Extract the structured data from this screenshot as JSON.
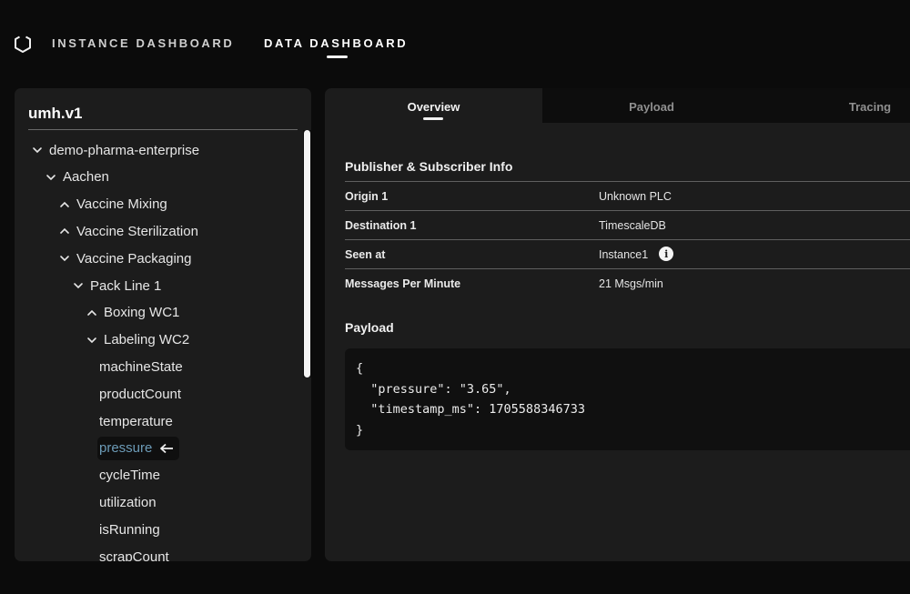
{
  "nav": {
    "logo_icon": "hexagon-logo-icon",
    "items": [
      {
        "label": "INSTANCE DASHBOARD",
        "active": false
      },
      {
        "label": "DATA DASHBOARD",
        "active": true
      }
    ]
  },
  "tree_panel": {
    "title": "umh.v1",
    "items": [
      {
        "label": "demo-pharma-enterprise",
        "level": 0,
        "chevron": "down"
      },
      {
        "label": "Aachen",
        "level": 1,
        "chevron": "down"
      },
      {
        "label": "Vaccine Mixing",
        "level": 2,
        "chevron": "up"
      },
      {
        "label": "Vaccine Sterilization",
        "level": 2,
        "chevron": "up"
      },
      {
        "label": "Vaccine Packaging",
        "level": 2,
        "chevron": "down"
      },
      {
        "label": "Pack Line 1",
        "level": 3,
        "chevron": "down"
      },
      {
        "label": "Boxing WC1",
        "level": 4,
        "chevron": "up"
      },
      {
        "label": "Labeling WC2",
        "level": 4,
        "chevron": "down"
      },
      {
        "label": "machineState",
        "level": 5,
        "chevron": "none"
      },
      {
        "label": "productCount",
        "level": 5,
        "chevron": "none"
      },
      {
        "label": "temperature",
        "level": 5,
        "chevron": "none"
      },
      {
        "label": "pressure",
        "level": 5,
        "chevron": "none",
        "selected": true
      },
      {
        "label": "cycleTime",
        "level": 5,
        "chevron": "none"
      },
      {
        "label": "utilization",
        "level": 5,
        "chevron": "none"
      },
      {
        "label": "isRunning",
        "level": 5,
        "chevron": "none"
      },
      {
        "label": "scrapCount",
        "level": 5,
        "chevron": "none"
      }
    ],
    "selected_color": "#6c9bb7"
  },
  "detail_panel": {
    "tabs": [
      {
        "label": "Overview",
        "active": true
      },
      {
        "label": "Payload",
        "active": false
      },
      {
        "label": "Tracing",
        "active": false
      }
    ],
    "info_section_title": "Publisher & Subscriber Info",
    "info_rows": [
      {
        "key": "Origin 1",
        "value": "Unknown PLC"
      },
      {
        "key": "Destination 1",
        "value": "TimescaleDB"
      },
      {
        "key": "Seen at",
        "value": "Instance1",
        "icon": "info-icon"
      },
      {
        "key": "Messages Per Minute",
        "value": "21 Msgs/min"
      }
    ],
    "payload_section_title": "Payload",
    "payload_lines": [
      "{",
      "  \"pressure\": \"3.65\",",
      "  \"timestamp_ms\": 1705588346733",
      "}"
    ]
  }
}
